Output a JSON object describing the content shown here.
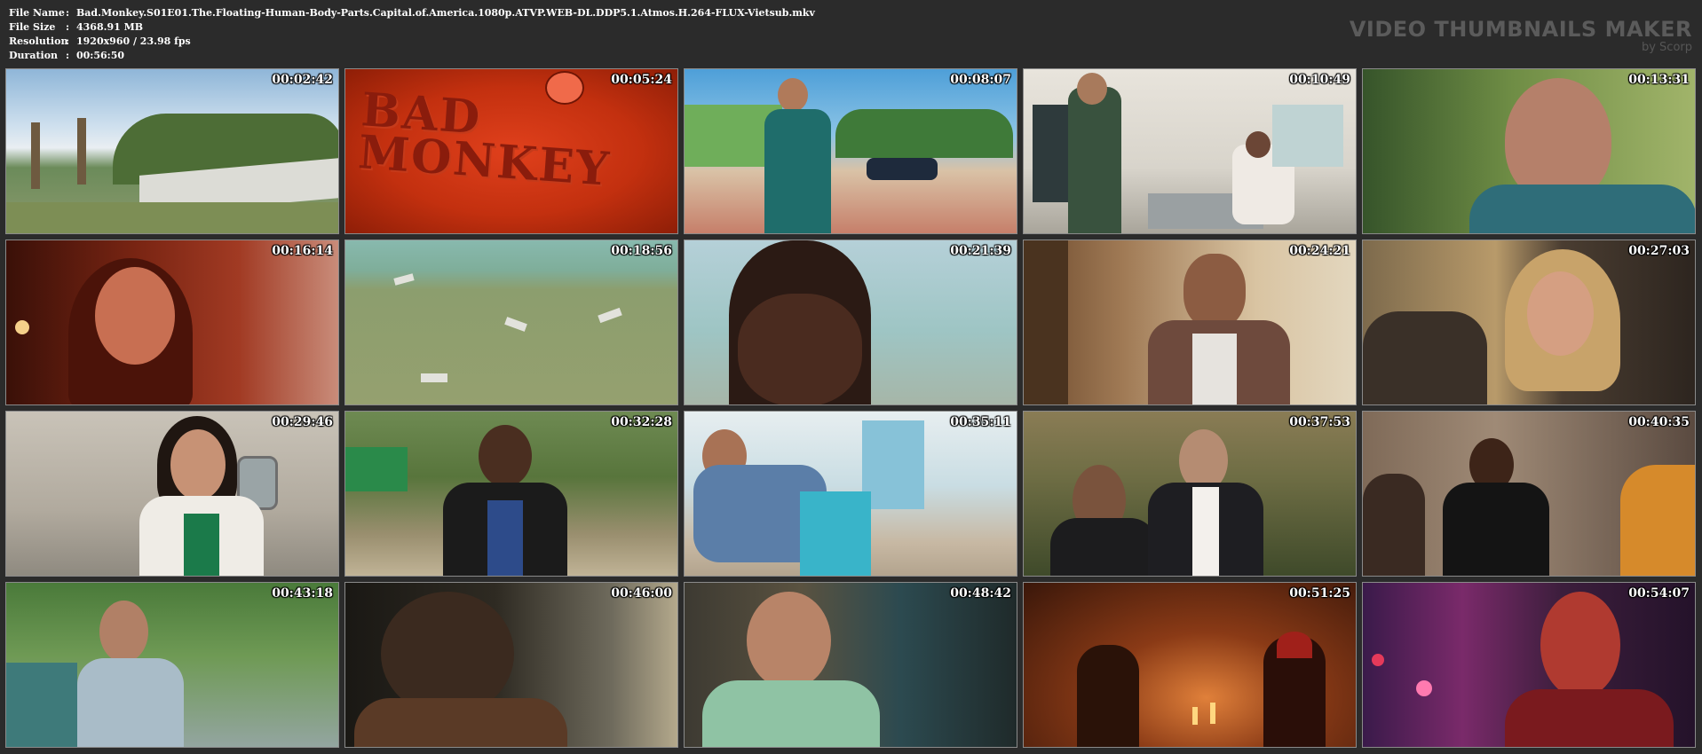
{
  "info": {
    "file_name_label": "File Name",
    "file_name": "Bad.Monkey.S01E01.The.Floating-Human-Body-Parts.Capital.of.America.1080p.ATVP.WEB-DL.DDP5.1.Atmos.H.264-FLUX-Vietsub.mkv",
    "file_size_label": "File Size",
    "file_size": "4368.91 MB",
    "resolution_label": "Resolution",
    "resolution": "1920x960 / 23.98 fps",
    "duration_label": "Duration",
    "duration": "00:56:50",
    "separator": ":"
  },
  "brand": {
    "title": "VIDEO THUMBNAILS MAKER",
    "subtitle": "by Scorp"
  },
  "logo_text_line1": "BAD",
  "logo_text_line2": "MONKEY",
  "thumbnails": [
    {
      "time": "00:02:42"
    },
    {
      "time": "00:05:24"
    },
    {
      "time": "00:08:07"
    },
    {
      "time": "00:10:49"
    },
    {
      "time": "00:13:31"
    },
    {
      "time": "00:16:14"
    },
    {
      "time": "00:18:56"
    },
    {
      "time": "00:21:39"
    },
    {
      "time": "00:24:21"
    },
    {
      "time": "00:27:03"
    },
    {
      "time": "00:29:46"
    },
    {
      "time": "00:32:28"
    },
    {
      "time": "00:35:11"
    },
    {
      "time": "00:37:53"
    },
    {
      "time": "00:40:35"
    },
    {
      "time": "00:43:18"
    },
    {
      "time": "00:46:00"
    },
    {
      "time": "00:48:42"
    },
    {
      "time": "00:51:25"
    },
    {
      "time": "00:54:07"
    }
  ]
}
